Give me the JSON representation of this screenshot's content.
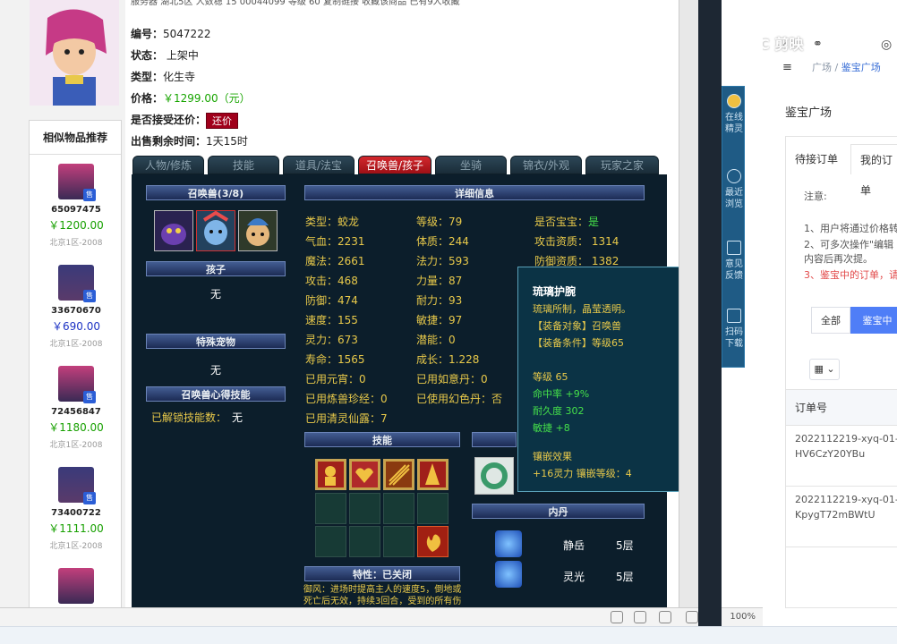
{
  "browser": {
    "top_cut_text": "服务器  湖北5区  人数稳      15  00044099      等级  60                  复制链接        收藏该商品            已有9人收藏",
    "status_zoom": "100%",
    "status_count": "0"
  },
  "sidebar": {
    "title": "相似物品推荐",
    "items": [
      {
        "id": "65097475",
        "price": "￥1200.00",
        "region": "北京1区-2008",
        "badge": "售"
      },
      {
        "id": "33670670",
        "price": "￥690.00",
        "region": "北京1区-2008",
        "badge": "售"
      },
      {
        "id": "72456847",
        "price": "￥1180.00",
        "region": "北京1区-2008",
        "badge": "售"
      },
      {
        "id": "73400722",
        "price": "￥1111.00",
        "region": "北京1区-2008",
        "badge": "售"
      }
    ]
  },
  "info": {
    "number_label": "编号：",
    "number": "5047222",
    "status_label": "状态：",
    "status": "上架中",
    "type_label": "类型：",
    "type": "化生寺",
    "price_label": "价格：",
    "price": "￥1299.00（元）",
    "bargain_label": "是否接受还价：",
    "bargain_button": "还价",
    "time_label": "出售剩余时间：",
    "time": "1天15时"
  },
  "tabs": [
    {
      "label": "人物/修炼"
    },
    {
      "label": "技能"
    },
    {
      "label": "道具/法宝"
    },
    {
      "label": "召唤兽/孩子",
      "active": true
    },
    {
      "label": "坐骑"
    },
    {
      "label": "锦衣/外观"
    },
    {
      "label": "玩家之家"
    }
  ],
  "panel": {
    "pet_header": "召唤兽(3/8)",
    "child_header": "孩子",
    "child_value": "无",
    "special_header": "特殊宠物",
    "special_value": "无",
    "heart_header": "召唤兽心得技能",
    "heart_label": "已解锁技能数：",
    "heart_value": "无",
    "detail_header": "详细信息",
    "skills_header": "技能",
    "neidan_header": "内丹",
    "trait_header": "特性：已关闭",
    "trait_text": "御风：进场时提高主人的速度5，倒地或死亡后无效，持续3回合，受到的所有伤",
    "stats": {
      "type": "类型：蛟龙",
      "level": "等级：79",
      "baobao_label": "是否宝宝：",
      "baobao": "是",
      "hp": "气血：2231",
      "tizhi": "体质：244",
      "gongji_zz": "攻击资质：  1314",
      "mofa": "魔法：2661",
      "fali": "法力：593",
      "fangyu_zz": "防御资质：  1382",
      "gongji": "攻击：468",
      "liliang": "力量：87",
      "fangyu": "防御：474",
      "naili": "耐力：93",
      "sudu": "速度：155",
      "minjie": "敏捷：97",
      "lingli": "灵力：673",
      "qianneng": "潜能：0",
      "shouming": "寿命：1565",
      "chengzhang": "成长：1.228",
      "yuanxiao": "已用元宵：0",
      "ruyi": "已用如意丹：0",
      "lianshou": "已用炼兽珍经：0",
      "huanse": "已使用幻色丹：否",
      "qingling": "已用清灵仙露：7"
    },
    "neidan": [
      {
        "name": "静岳",
        "level": "5层"
      },
      {
        "name": "灵光",
        "level": "5层"
      }
    ]
  },
  "tooltip": {
    "title": "琉璃护腕",
    "desc": "琉璃所制，晶莹透明。",
    "target": "【装备对象】召唤兽",
    "condition": "【装备条件】等级65",
    "level": "等级  65",
    "hit": "命中率  +9%",
    "durability": "耐久度  302",
    "agility": "敏捷  +8",
    "inlay_title": "镶嵌效果",
    "inlay": "+16灵力  镶嵌等级：4"
  },
  "sidenav": [
    {
      "label": "在线精灵"
    },
    {
      "label": "最近浏览"
    },
    {
      "label": "意见反馈"
    },
    {
      "label": "扫码下载"
    }
  ],
  "right": {
    "watermark": "C 剪映",
    "breadcrumb_home": "广场",
    "breadcrumb_sep": "/",
    "breadcrumb_current": "鉴宝广场",
    "title": "鉴宝广场",
    "tab_pending": "待接订单",
    "tab_mine": "我的订单",
    "note_title": "注意:",
    "note1": "1、用户将通过价格转",
    "note2": "2、可多次操作\"编辑",
    "note2b": "内容后再次提。",
    "note3": "3、鉴宝中的订单，请",
    "filter_all": "全部",
    "filter_active": "鉴宝中",
    "table_header": "订单号",
    "orders": [
      "2022112219-xyq-01-BHV6CzY20YBu",
      "2022112219-xyq-01-lKpygT72mBWtU"
    ]
  }
}
